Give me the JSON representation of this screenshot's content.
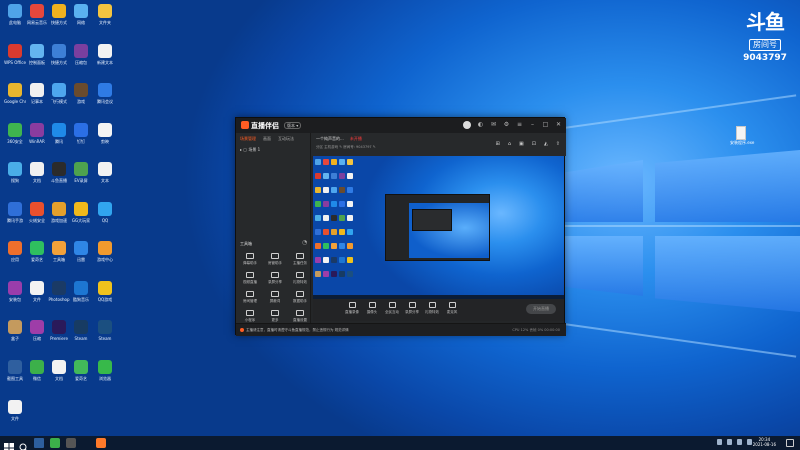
{
  "desktop": {
    "icons": [
      {
        "label": "此电脑",
        "color": "#4fa3e8"
      },
      {
        "label": "网易云音乐",
        "color": "#e5473c"
      },
      {
        "label": "快捷方式",
        "color": "#f0b21f"
      },
      {
        "label": "网络",
        "color": "#5ab1f0"
      },
      {
        "label": "文件夹",
        "color": "#f3c440"
      },
      {
        "label": "WPS Office",
        "color": "#d93a2f"
      },
      {
        "label": "控制面板",
        "color": "#63b4f0"
      },
      {
        "label": "快捷方式",
        "color": "#3d7fd6"
      },
      {
        "label": "压缩包",
        "color": "#7a3f9f"
      },
      {
        "label": "新建文本",
        "color": "#f2f2f2"
      },
      {
        "label": "Google Chrome",
        "color": "#e8b62f"
      },
      {
        "label": "记事本",
        "color": "#f0f0f0"
      },
      {
        "label": "飞行模式",
        "color": "#4da6ee"
      },
      {
        "label": "游戏",
        "color": "#6a4b2d"
      },
      {
        "label": "腾讯会议",
        "color": "#2f7be5"
      },
      {
        "label": "360安全",
        "color": "#3fb44f"
      },
      {
        "label": "WinRAR",
        "color": "#8a3c9f"
      },
      {
        "label": "腾讯",
        "color": "#1f8ae8"
      },
      {
        "label": "钉钉",
        "color": "#2b6fe5"
      },
      {
        "label": "剪映",
        "color": "#f3f3f3"
      },
      {
        "label": "搜狗",
        "color": "#4aaee8"
      },
      {
        "label": "文档",
        "color": "#f0f0f0"
      },
      {
        "label": "斗鱼直播",
        "color": "#2b2b2b"
      },
      {
        "label": "EV录屏",
        "color": "#4ea24e"
      },
      {
        "label": "文本",
        "color": "#f2f2f2"
      },
      {
        "label": "腾讯手游",
        "color": "#2f6fd8"
      },
      {
        "label": "火绒安全",
        "color": "#e9502e"
      },
      {
        "label": "游戏加速",
        "color": "#e4a02c"
      },
      {
        "label": "GG大玩家",
        "color": "#f0b91c"
      },
      {
        "label": "QQ",
        "color": "#31a5ef"
      },
      {
        "label": "应用",
        "color": "#ee6f2c"
      },
      {
        "label": "爱奇艺",
        "color": "#2fbf5f"
      },
      {
        "label": "工具箱",
        "color": "#f2a13a"
      },
      {
        "label": "迅雷",
        "color": "#2f86e6"
      },
      {
        "label": "游戏中心",
        "color": "#f19a2e"
      },
      {
        "label": "安装包",
        "color": "#9a3dab"
      },
      {
        "label": "文件",
        "color": "#f2f2f2"
      },
      {
        "label": "Photoshop",
        "color": "#1a3a66"
      },
      {
        "label": "酷狗音乐",
        "color": "#1d76d2"
      },
      {
        "label": "QQ游戏",
        "color": "#f0c21c"
      },
      {
        "label": "盒子",
        "color": "#c49a5e"
      },
      {
        "label": "压缩",
        "color": "#9e3da8"
      },
      {
        "label": "Premiere",
        "color": "#2a1a5a"
      },
      {
        "label": "Steam",
        "color": "#173b63"
      },
      {
        "label": "Steam",
        "color": "#1b4f80"
      },
      {
        "label": "截图工具",
        "color": "#2f5f9f"
      },
      {
        "label": "微信",
        "color": "#3cb04a"
      },
      {
        "label": "文档",
        "color": "#f2f2f2"
      },
      {
        "label": "爱奇艺",
        "color": "#42b95a"
      },
      {
        "label": "浏览器",
        "color": "#37b94a"
      },
      {
        "label": "文件",
        "color": "#f2f2f2"
      }
    ],
    "right_file_label": "安装程序.exe"
  },
  "douyu": {
    "logo_text": "斗鱼",
    "room_label": "房间号",
    "room_number": "9043797"
  },
  "app": {
    "title": "直播伴侣",
    "version_badge": "版本 ▾",
    "tabs": [
      "场景管理",
      "画面",
      "互动玩法"
    ],
    "scene_label": "场景 1",
    "tools_title": "工具箱",
    "tools": [
      "弹幕助手",
      "房管助手",
      "主播任务",
      "视频直播",
      "录屏分享",
      "礼物特效",
      "房间管理",
      "屏蔽词",
      "数据助手",
      "小程序",
      "更多",
      "直播设置"
    ],
    "room_title": "一个纯声音的...",
    "room_tag": "未开播",
    "room_meta": "分区  主机游戏  ✎     房间号: 9043797  ✎",
    "bottom_buttons": [
      "直播录像",
      "摄像头",
      "全民互动",
      "录屏分享",
      "礼物特效",
      "麦克风"
    ],
    "start_live": "开始直播",
    "status_text": "主播请注意，直播时请遵守斗鱼直播规范，禁止违规行为 规范详情",
    "status_right": "CPU 12%   丢帧 0%   00:00:00"
  },
  "taskbar": {
    "time": "20:34",
    "date": "2021-08-16"
  }
}
